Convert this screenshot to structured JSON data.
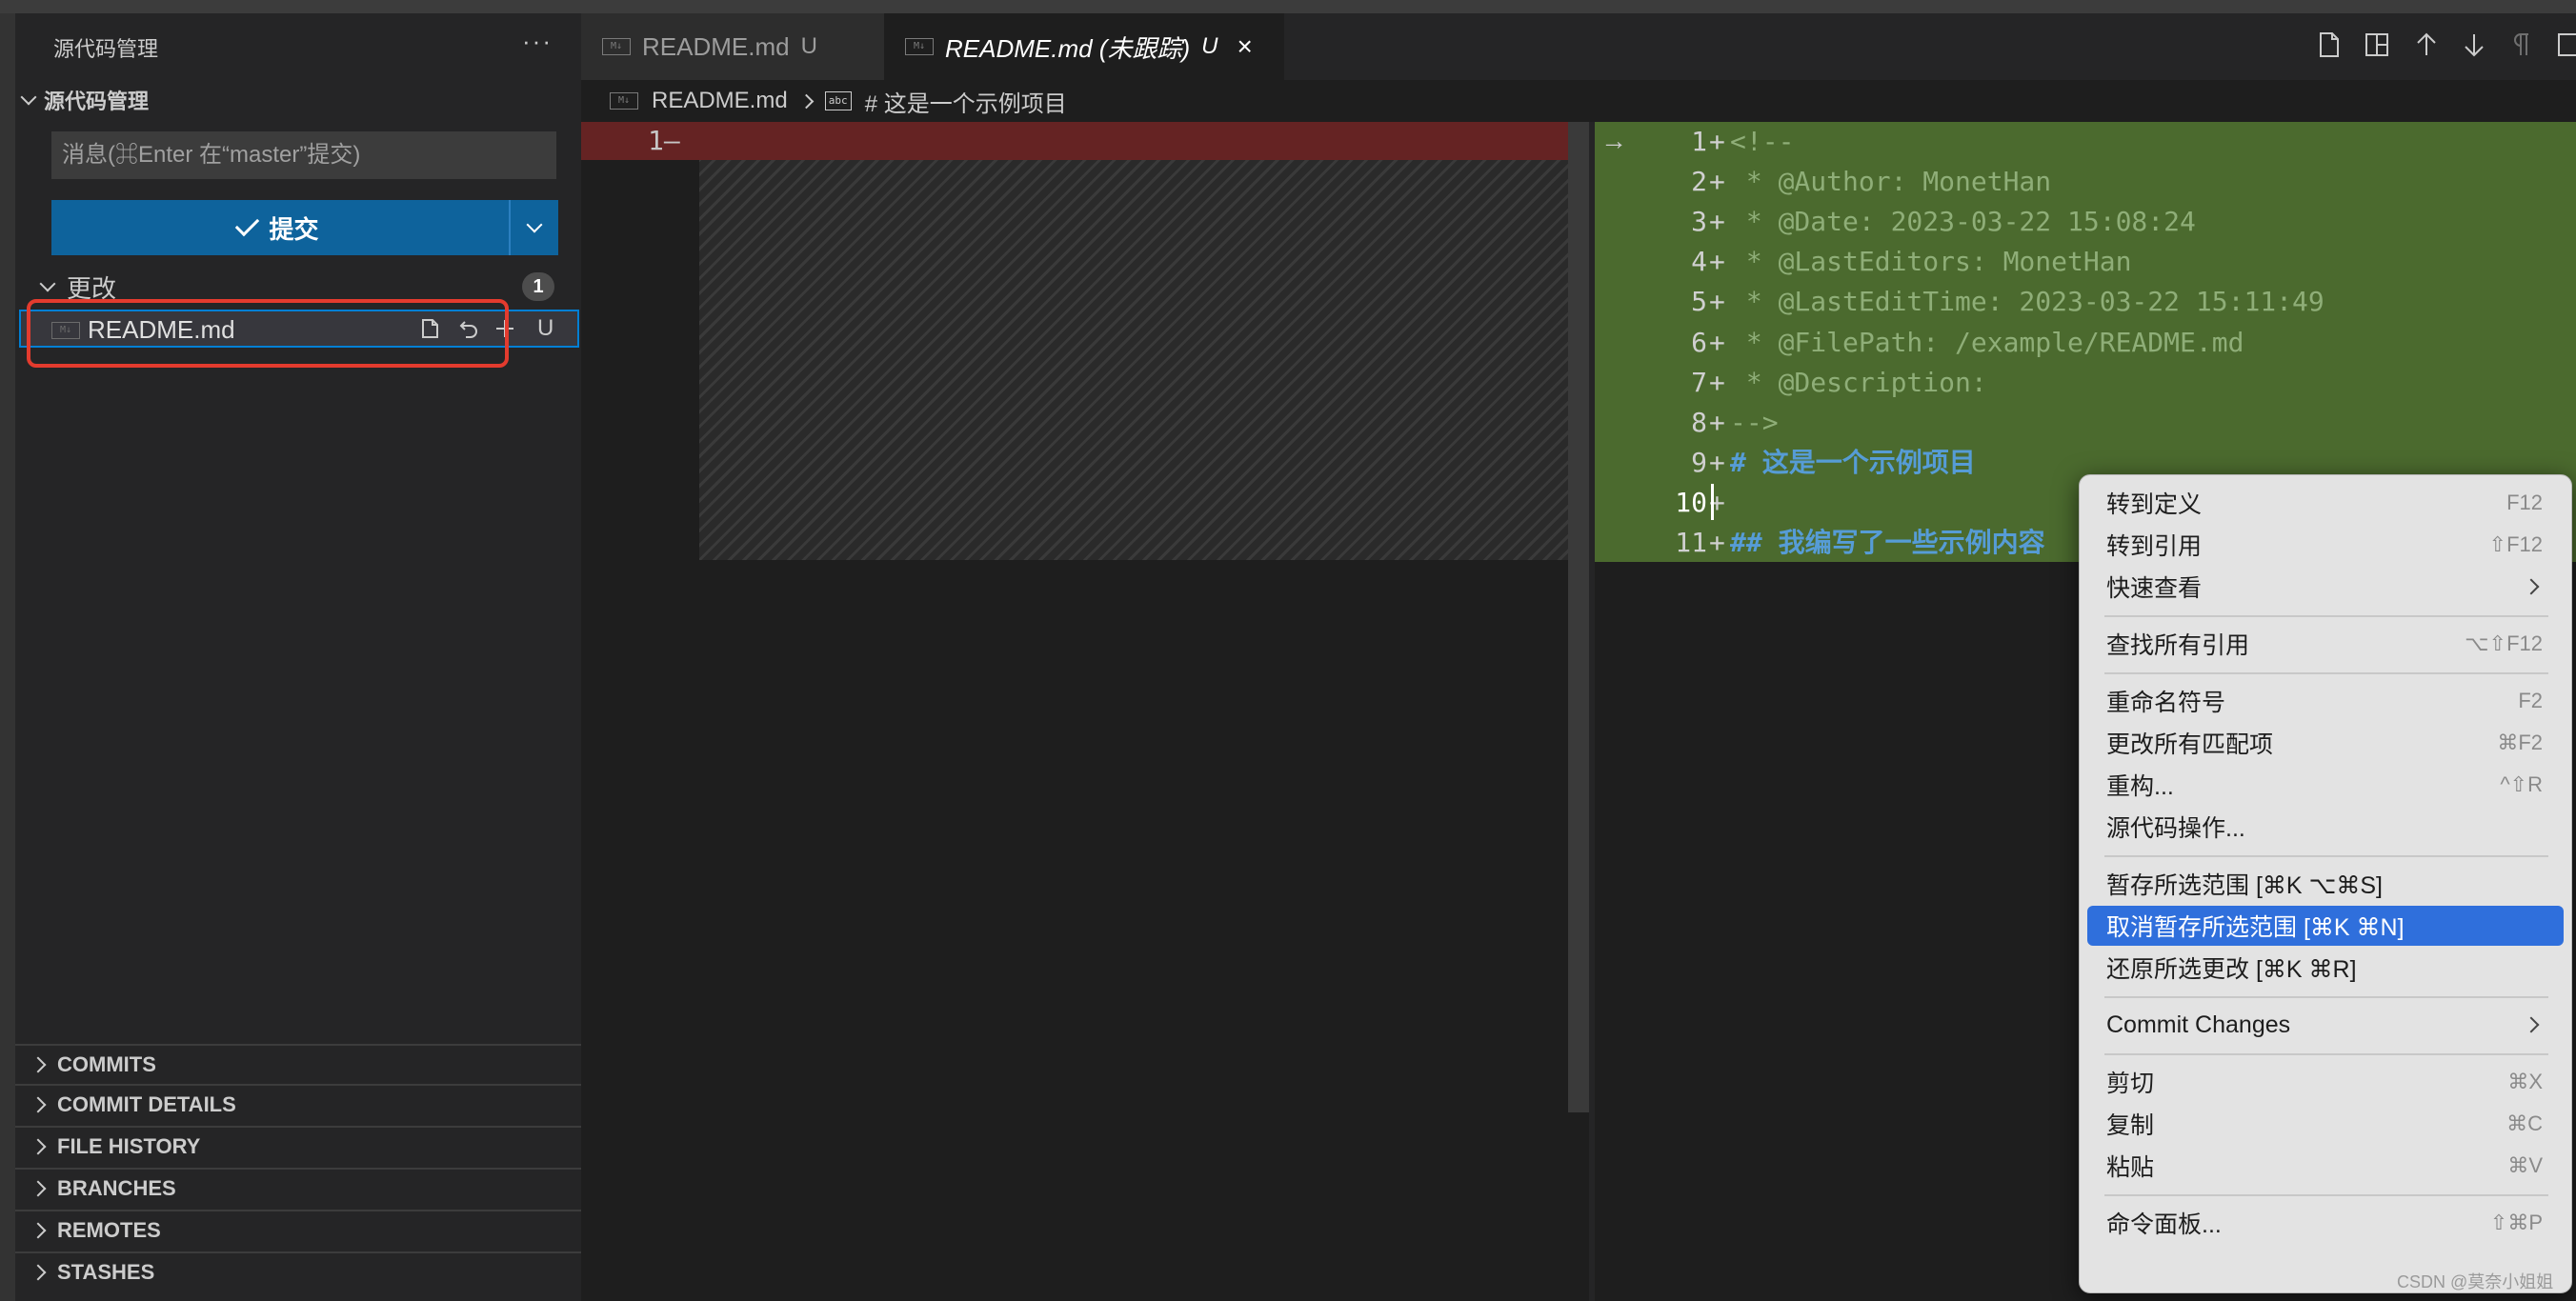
{
  "sidebar": {
    "title": "源代码管理",
    "more": "···",
    "scm_header": "源代码管理",
    "message_placeholder": "消息(⌘Enter 在“master”提交)",
    "commit_label": "提交",
    "changes_label": "更改",
    "changes_count": "1",
    "file": {
      "name": "README.md",
      "status": "U",
      "icon_text": "M↓"
    },
    "panels": [
      "COMMITS",
      "COMMIT DETAILS",
      "FILE HISTORY",
      "BRANCHES",
      "REMOTES",
      "STASHES"
    ]
  },
  "tabs": [
    {
      "label": "README.md",
      "status": "U",
      "icon_text": "M↓"
    },
    {
      "label": "README.md (未跟踪)",
      "status": "U",
      "icon_text": "M↓",
      "close": "×"
    }
  ],
  "breadcrumb": {
    "file": "README.md",
    "symbol_icon": "abc",
    "symbol": "# 这是一个示例项目"
  },
  "diff_left": {
    "line_num": "1",
    "marker": "—"
  },
  "diff_right": {
    "arrow": "→",
    "lines": [
      {
        "num": "1",
        "text": "<!--",
        "kind": "comment"
      },
      {
        "num": "2",
        "text": " * @Author: MonetHan",
        "kind": "comment"
      },
      {
        "num": "3",
        "text": " * @Date: 2023-03-22 15:08:24",
        "kind": "comment"
      },
      {
        "num": "4",
        "text": " * @LastEditors: MonetHan",
        "kind": "comment"
      },
      {
        "num": "5",
        "text": " * @LastEditTime: 2023-03-22 15:11:49",
        "kind": "comment"
      },
      {
        "num": "6",
        "text": " * @FilePath: /example/README.md",
        "kind": "comment"
      },
      {
        "num": "7",
        "text": " * @Description:",
        "kind": "comment"
      },
      {
        "num": "8",
        "text": "-->",
        "kind": "comment"
      },
      {
        "num": "9",
        "text": "# 这是一个示例项目",
        "kind": "heading"
      },
      {
        "num": "10",
        "text": "",
        "kind": "plain"
      },
      {
        "num": "11",
        "text": "## 我编写了一些示例内容",
        "kind": "heading"
      }
    ]
  },
  "context_menu": {
    "items": [
      {
        "label": "转到定义",
        "shortcut": "F12"
      },
      {
        "label": "转到引用",
        "shortcut": "⇧F12"
      },
      {
        "label": "快速查看",
        "submenu": true
      },
      {
        "sep": true
      },
      {
        "label": "查找所有引用",
        "shortcut": "⌥⇧F12"
      },
      {
        "sep": true
      },
      {
        "label": "重命名符号",
        "shortcut": "F2"
      },
      {
        "label": "更改所有匹配项",
        "shortcut": "⌘F2"
      },
      {
        "label": "重构...",
        "shortcut": "^⇧R"
      },
      {
        "label": "源代码操作..."
      },
      {
        "sep": true
      },
      {
        "label": "暂存所选范围 [⌘K ⌥⌘S]"
      },
      {
        "label": "取消暂存所选范围 [⌘K ⌘N]",
        "active": true
      },
      {
        "label": "还原所选更改 [⌘K ⌘R]"
      },
      {
        "sep": true
      },
      {
        "label": "Commit Changes",
        "submenu": true
      },
      {
        "sep": true
      },
      {
        "label": "剪切",
        "shortcut": "⌘X"
      },
      {
        "label": "复制",
        "shortcut": "⌘C"
      },
      {
        "label": "粘贴",
        "shortcut": "⌘V"
      },
      {
        "sep": true
      },
      {
        "label": "命令面板...",
        "shortcut": "⇧⌘P"
      }
    ]
  },
  "watermark": "CSDN @莫奈小姐姐",
  "colors": {
    "accent": "#0e639c",
    "added_bg": "#4b6a2e",
    "removed_bg": "#8a2a2a",
    "highlight": "#e33b2e",
    "menu_active": "#2f6fdc"
  }
}
